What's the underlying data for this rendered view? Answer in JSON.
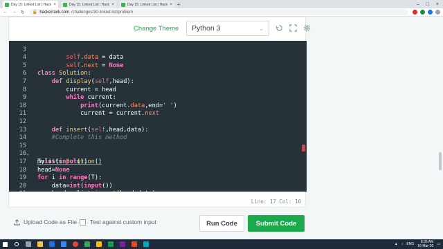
{
  "browser": {
    "tabs": [
      {
        "title": "Day 15: Linked List | HackerRank",
        "active": true
      },
      {
        "title": "Day 15: Linked List | HackerRank",
        "active": false
      },
      {
        "title": "Day 15: Linked List | HackerRank",
        "active": false
      }
    ],
    "url_host": "hackerrank.com",
    "url_path": "/challenges/30-linked-list/problem"
  },
  "toolbar": {
    "change_theme": "Change Theme",
    "language": "Python 3"
  },
  "editor": {
    "lines": [
      {
        "n": "3"
      },
      {
        "n": "4"
      },
      {
        "n": "5"
      },
      {
        "n": "6"
      },
      {
        "n": "7"
      },
      {
        "n": "8"
      },
      {
        "n": "9"
      },
      {
        "n": "10"
      },
      {
        "n": "11"
      },
      {
        "n": "12"
      },
      {
        "n": "13"
      },
      {
        "n": "14"
      },
      {
        "n": "15"
      },
      {
        "n": "16"
      },
      {
        "n": "17"
      },
      {
        "n": "18"
      },
      {
        "n": "19"
      },
      {
        "n": "20"
      },
      {
        "n": "21"
      }
    ],
    "comment": "#Complete this method",
    "end_arg": "' '"
  },
  "status": {
    "text": "Line: 17 Col: 10"
  },
  "actions": {
    "upload_label": "Upload Code as File",
    "custom_input_label": "Test against custom input",
    "run_label": "Run Code",
    "submit_label": "Submit Code"
  },
  "taskbar": {
    "lang": "ENG",
    "time": "8:35 AM",
    "date": "16-Mar-20"
  },
  "colors": {
    "accent": "#1ba94c",
    "editor_bg": "#263238"
  }
}
